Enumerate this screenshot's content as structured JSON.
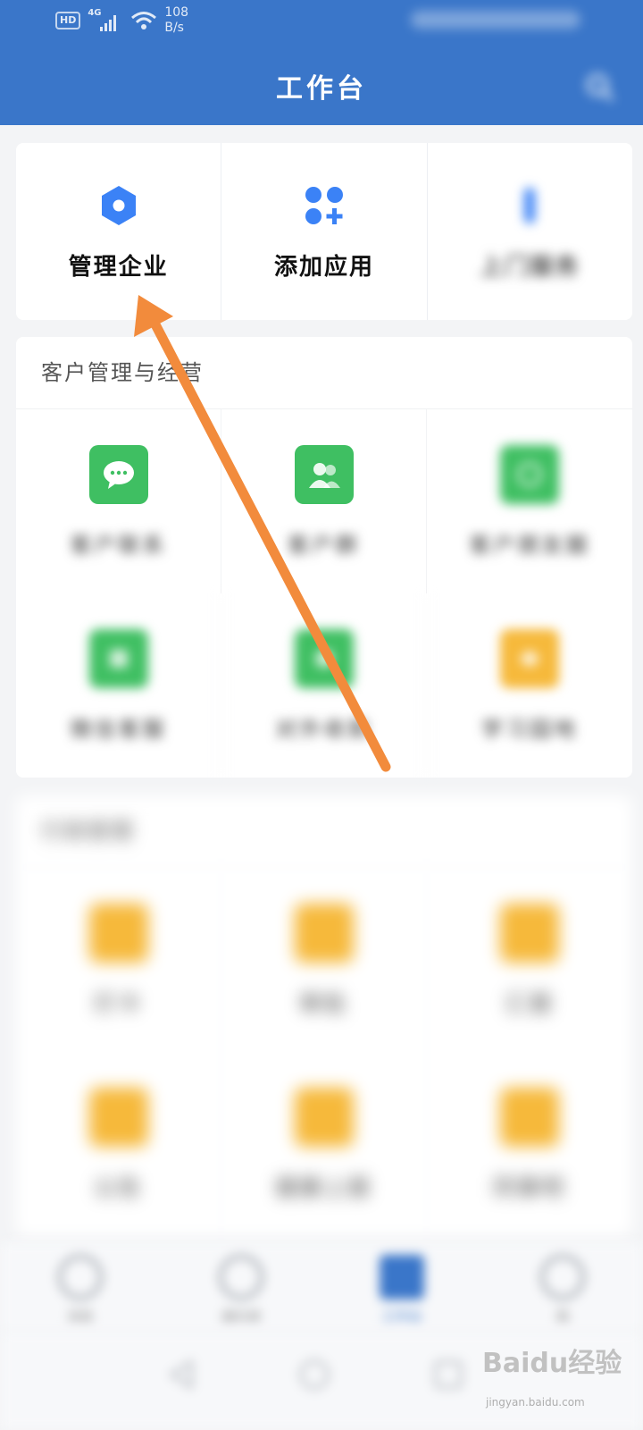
{
  "status_bar": {
    "hd": "HD",
    "network": "4G",
    "speed_value": "108",
    "speed_unit": "B/s"
  },
  "header": {
    "title": "工作台"
  },
  "top_actions": [
    {
      "label": "管理企业",
      "icon": "hexagon-settings-icon"
    },
    {
      "label": "添加应用",
      "icon": "add-apps-icon"
    },
    {
      "label": "上门服务",
      "icon": "tool-icon"
    }
  ],
  "section_customer": {
    "title": "客户管理与经营",
    "apps": [
      {
        "label": "客户联系",
        "icon": "chat-bubble-icon"
      },
      {
        "label": "客户群",
        "icon": "group-icon"
      },
      {
        "label": "客户朋友圈",
        "icon": "moments-icon"
      },
      {
        "label": "微信客服",
        "icon": "service-icon"
      },
      {
        "label": "对外收款",
        "icon": "payment-icon"
      },
      {
        "label": "学习园地",
        "icon": "learning-icon"
      }
    ]
  },
  "section_office": {
    "title": "行政管理",
    "apps": [
      {
        "label": "打卡",
        "icon": "punch-icon"
      },
      {
        "label": "审批",
        "icon": "approval-icon"
      },
      {
        "label": "汇报",
        "icon": "report-icon"
      },
      {
        "label": "公告",
        "icon": "announce-icon"
      },
      {
        "label": "健康上报",
        "icon": "health-icon"
      },
      {
        "label": "同事吧",
        "icon": "community-icon"
      }
    ]
  },
  "bottom_nav": [
    {
      "label": "消息",
      "icon": "message-icon",
      "active": false
    },
    {
      "label": "通讯录",
      "icon": "contacts-icon",
      "active": false
    },
    {
      "label": "工作台",
      "icon": "workbench-icon",
      "active": true
    },
    {
      "label": "我",
      "icon": "profile-icon",
      "active": false
    }
  ],
  "watermark": {
    "text": "Baidu经验",
    "url": "jingyan.baidu.com"
  },
  "colors": {
    "header_blue": "#3a76c9",
    "accent_blue": "#3b82f6",
    "green": "#3fbf62",
    "yellow": "#f6b93b",
    "arrow": "#f28b3c"
  }
}
